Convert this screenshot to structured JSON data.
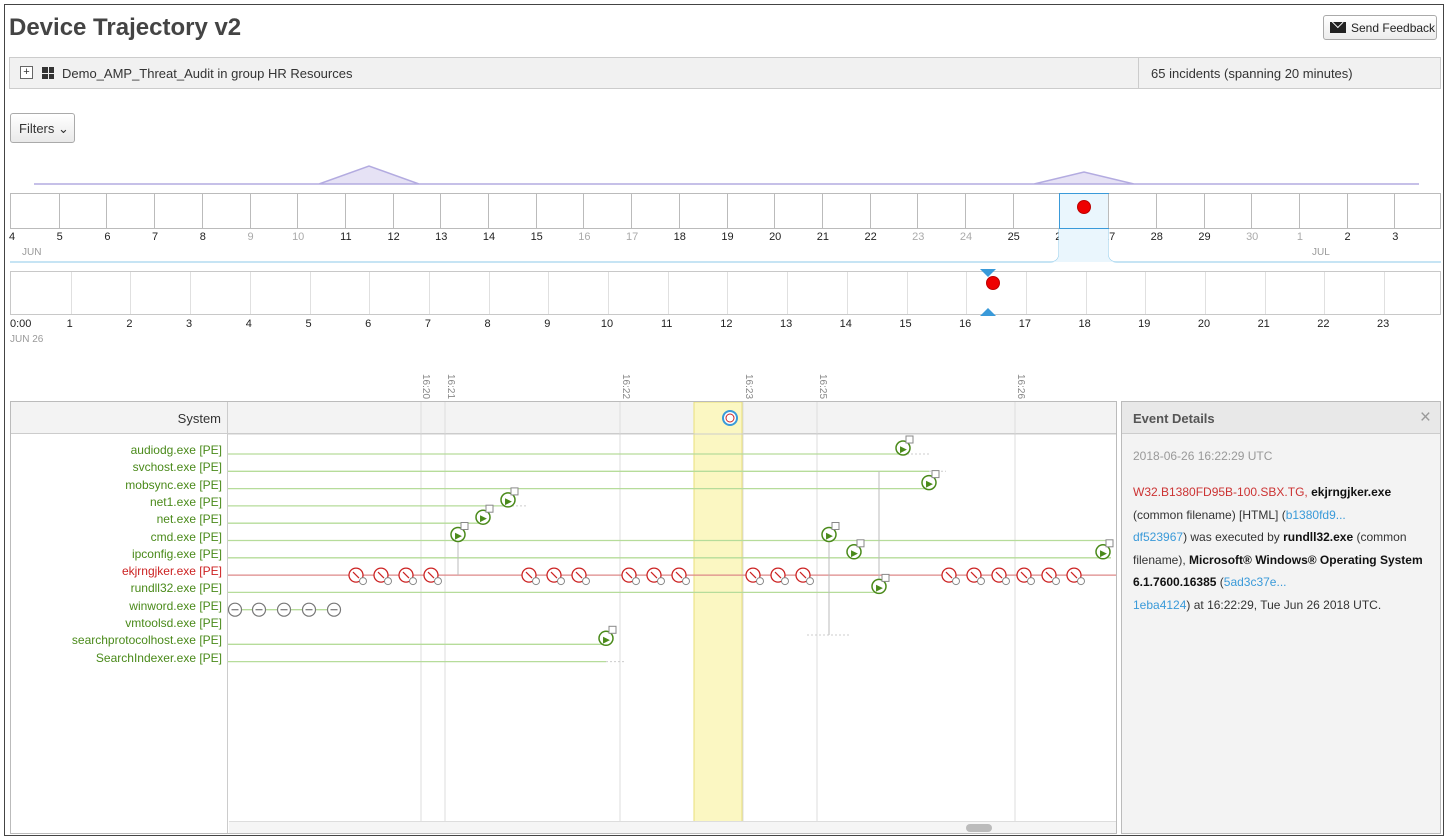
{
  "header": {
    "title": "Device Trajectory v2",
    "feedback_label": "Send Feedback"
  },
  "device": {
    "expand": "+",
    "name": "Demo_AMP_Threat_Audit in group HR Resources",
    "incidents": "65 incidents (spanning 20 minutes)"
  },
  "filters": {
    "label": "Filters ⌄"
  },
  "day_timeline": {
    "days": [
      {
        "d": "4",
        "dim": false
      },
      {
        "d": "5",
        "dim": false
      },
      {
        "d": "6",
        "dim": false
      },
      {
        "d": "7",
        "dim": false
      },
      {
        "d": "8",
        "dim": false
      },
      {
        "d": "9",
        "dim": true
      },
      {
        "d": "10",
        "dim": true
      },
      {
        "d": "11",
        "dim": false
      },
      {
        "d": "12",
        "dim": false
      },
      {
        "d": "13",
        "dim": false
      },
      {
        "d": "14",
        "dim": false
      },
      {
        "d": "15",
        "dim": false
      },
      {
        "d": "16",
        "dim": true
      },
      {
        "d": "17",
        "dim": true
      },
      {
        "d": "18",
        "dim": false
      },
      {
        "d": "19",
        "dim": false
      },
      {
        "d": "20",
        "dim": false
      },
      {
        "d": "21",
        "dim": false
      },
      {
        "d": "22",
        "dim": false
      },
      {
        "d": "23",
        "dim": true
      },
      {
        "d": "24",
        "dim": true
      },
      {
        "d": "25",
        "dim": false
      },
      {
        "d": "26",
        "dim": false
      },
      {
        "d": "27",
        "dim": false
      },
      {
        "d": "28",
        "dim": false
      },
      {
        "d": "29",
        "dim": false
      },
      {
        "d": "30",
        "dim": true
      },
      {
        "d": "1",
        "dim": true
      },
      {
        "d": "2",
        "dim": false
      },
      {
        "d": "3",
        "dim": false
      }
    ],
    "month_start": "JUN",
    "month_end": "JUL",
    "selected_day": "26"
  },
  "hour_timeline": {
    "hours": [
      "0:00",
      "1",
      "2",
      "3",
      "4",
      "5",
      "6",
      "7",
      "8",
      "9",
      "10",
      "11",
      "12",
      "13",
      "14",
      "15",
      "16",
      "17",
      "18",
      "19",
      "20",
      "21",
      "22",
      "23"
    ],
    "date_label": "JUN 26",
    "event_hour": 16.3
  },
  "time_marks": [
    "16:20",
    "16:21",
    "16:22",
    "16:23",
    "16:25",
    "16:26"
  ],
  "trajectory": {
    "system_label": "System",
    "processes": [
      {
        "name": "audiodg.exe [PE]",
        "malicious": false
      },
      {
        "name": "svchost.exe [PE]",
        "malicious": false
      },
      {
        "name": "mobsync.exe [PE]",
        "malicious": false
      },
      {
        "name": "net1.exe [PE]",
        "malicious": false
      },
      {
        "name": "net.exe [PE]",
        "malicious": false
      },
      {
        "name": "cmd.exe [PE]",
        "malicious": false
      },
      {
        "name": "ipconfig.exe [PE]",
        "malicious": false
      },
      {
        "name": "ekjrngjker.exe [PE]",
        "malicious": true
      },
      {
        "name": "rundll32.exe [PE]",
        "malicious": false
      },
      {
        "name": "winword.exe [PE]",
        "malicious": false
      },
      {
        "name": "vmtoolsd.exe [PE]",
        "malicious": false
      },
      {
        "name": "searchprotocolhost.exe [PE]",
        "malicious": false
      },
      {
        "name": "SearchIndexer.exe [PE]",
        "malicious": false
      }
    ]
  },
  "details": {
    "title": "Event Details",
    "close": "×",
    "timestamp": "2018-06-26 16:22:29 UTC",
    "detection": "W32.B1380FD95B-100.SBX.TG,",
    "filename": "ekjrngjker.exe",
    "text1": "(common filename) [HTML] (",
    "hash1a": "b1380fd9...",
    "hash1b": "df523967",
    "text2": ") was executed by ",
    "parent": "rundll32.exe",
    "text3": "(common filename), ",
    "os": "Microsoft® Windows® Operating System 6.1.7600.16385",
    "text4": " (",
    "hash2a": "5ad3c37e...",
    "hash2b": "1eba4124",
    "text5": ") at 16:22:29, Tue Jun 26 2018 UTC."
  },
  "colors": {
    "malicious": "#cc2222",
    "clean": "#4a8a1a",
    "link": "#3a9ad9",
    "highlight": "#fbf7c2"
  }
}
